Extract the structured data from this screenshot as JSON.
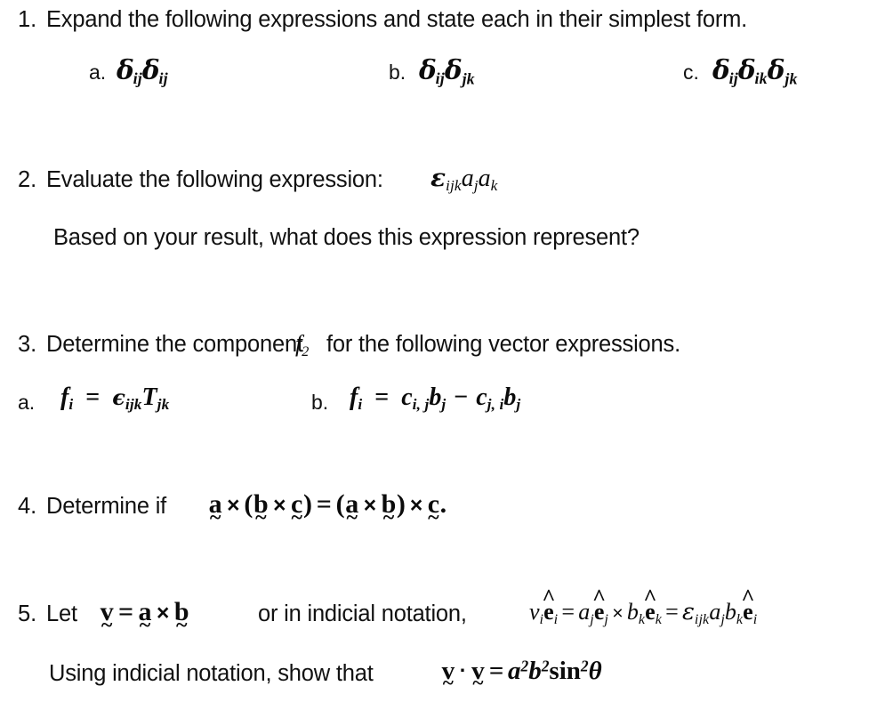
{
  "document": {
    "kind": "problem-set",
    "topic": "indicial-notation",
    "background_color": "#ffffff",
    "text_color": "#111111"
  },
  "problems": [
    {
      "number": "1.",
      "prompt": "Expand the following expressions and state each in their simplest form.",
      "parts": [
        {
          "label": "a.",
          "expression": "δijδij"
        },
        {
          "label": "b.",
          "expression": "δijδjk"
        },
        {
          "label": "c.",
          "expression": "δijδikδjk"
        }
      ]
    },
    {
      "number": "2.",
      "prompt": "Evaluate the following expression:",
      "expression": "εijk aj ak",
      "followup": "Based on your result, what does this expression represent?"
    },
    {
      "number": "3.",
      "prompt_before": "Determine the component",
      "prompt_symbol": "f2",
      "prompt_after": "for the following vector expressions.",
      "parts": [
        {
          "label": "a.",
          "expression": "fi = εijk Tjk"
        },
        {
          "label": "b.",
          "expression": "fi = ci,j bj − cj,i bj"
        }
      ]
    },
    {
      "number": "4.",
      "prompt": "Determine if",
      "expression": "a × (b × c) = (a × b) × c."
    },
    {
      "number": "5.",
      "prompt": "Let",
      "expression_vector": "v = a × b",
      "prompt_mid": "or in indicial notation,",
      "expression_indicial": "vi ê i = aj ê j × bk ê k = εijk aj bk ê i",
      "prompt_last": "Using indicial notation, show that",
      "expression_last": "v · v = a²b²sin²θ"
    }
  ],
  "symbols": {
    "delta": "δ",
    "epsilon_light": "ε",
    "epsilon_bold": "ϵ",
    "theta": "θ",
    "times": "×",
    "dot": "·",
    "minus": "−",
    "equals": "=",
    "hat": "ˆ",
    "tilde": "~"
  },
  "indices": {
    "i": "i",
    "j": "j",
    "k": "k",
    "ij": "ij",
    "jk": "jk",
    "ik": "ik",
    "ijk": "ijk",
    "two": "2",
    "comma_ij": "i, j",
    "comma_ji": "j, i"
  },
  "letters": {
    "a": "a",
    "b": "b",
    "c": "c",
    "e": "e",
    "f": "f",
    "v": "v",
    "T": "T",
    "sin": "sin"
  }
}
